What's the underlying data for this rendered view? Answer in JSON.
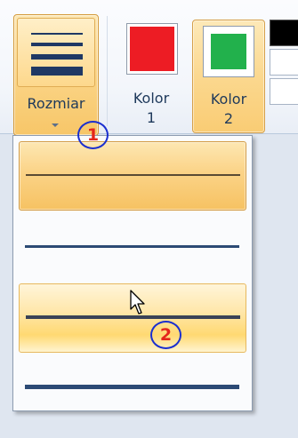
{
  "ribbon": {
    "size_button": {
      "label": "Rozmiar",
      "icon": "line-size-icon"
    },
    "color1_button": {
      "label_line1": "Kolor",
      "label_line2": "1",
      "swatch_color": "#ed1c24"
    },
    "color2_button": {
      "label_line1": "Kolor",
      "label_line2": "2",
      "swatch_color": "#22b14c"
    },
    "palette": [
      {
        "name": "black",
        "color": "#000000"
      },
      {
        "name": "white",
        "color": "#ffffff"
      },
      {
        "name": "white-2",
        "color": "#ffffff"
      }
    ]
  },
  "size_menu": {
    "options": [
      {
        "name": "size-1",
        "state": "selected"
      },
      {
        "name": "size-2",
        "state": "normal"
      },
      {
        "name": "size-3",
        "state": "hovered"
      },
      {
        "name": "size-4",
        "state": "normal"
      }
    ]
  },
  "annotations": {
    "step1": "1",
    "step2": "2"
  },
  "colors": {
    "highlight_border": "#d39a41",
    "highlight_fill": "#fbd387",
    "ribbon_text": "#1e395b",
    "line_color": "#2c4a75",
    "annotation_ring": "#1b2fcf",
    "annotation_digit": "#e4261c"
  }
}
